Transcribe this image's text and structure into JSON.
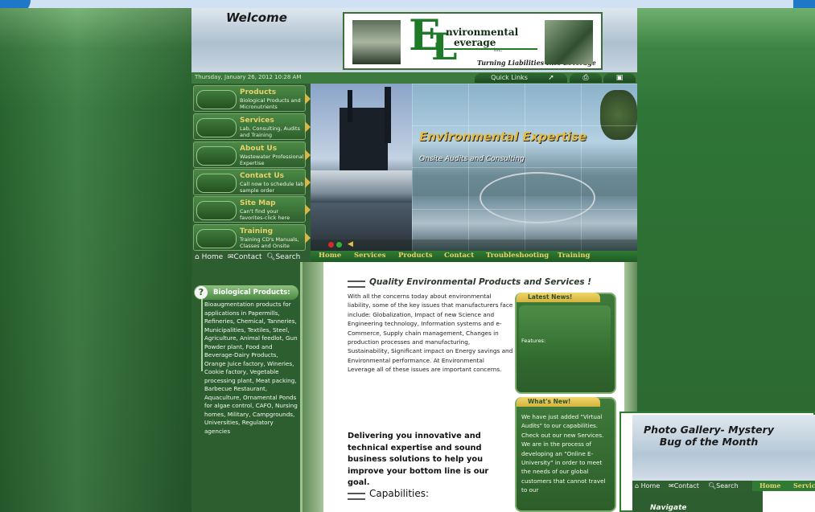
{
  "header": {
    "welcome": "Welcome",
    "logo": {
      "big_e": "E",
      "big_l": "L",
      "word1": "nvironmental",
      "word2": "everage",
      "inc": "inc.",
      "tagline": "Turning Liabilities Into Leverage"
    },
    "date": "Thursday, January 26, 2012        10:28 AM",
    "quick_links": "Quick Links"
  },
  "nav": [
    {
      "title": "Products",
      "desc": "Biological Products and Micronutrients"
    },
    {
      "title": "Services",
      "desc": "Lab, Consulting, Audits and Training"
    },
    {
      "title": "About Us",
      "desc": "Wastewater Professional Expertise"
    },
    {
      "title": "Contact Us",
      "desc": "Call now to schedule lab sample order"
    },
    {
      "title": "Site Map",
      "desc": "Can't find your favorites-click here"
    },
    {
      "title": "Training",
      "desc": "Training CD's Manuals, Classes and Onsite"
    }
  ],
  "utility": {
    "home": "Home",
    "contact": "Contact",
    "search": "Search"
  },
  "hero": {
    "title": "Environmental Expertise",
    "subtitle": "Onsite Audits and Consulting"
  },
  "topnav": [
    "Home",
    "Services",
    "Products",
    "Contact",
    "Troubleshooting",
    "Training"
  ],
  "bio": {
    "title": "Biological Products:",
    "text": "Bioaugmentation products for applications in Papermills, Refineries, Chemical, Tanneries, Municipalities, Textiles, Steel, Agriculture, Animal feedlot, Gun Powder plant, Food and Beverage-Dairy Products, Orange Juice factory, Wineries, Cookie factory, Vegetable processing plant, Meat packing, Barbecue Restaurant, Aquaculture, Ornamental Ponds for algae control, CAFO, Nursing homes, Military, Campgrounds, Universities, Regulatory agencies"
  },
  "main": {
    "heading": "Quality Environmental Products and Services !",
    "intro": "With all the concerns today about environmental liability, some of the key issues that manufacturers face include: Globalization, Impact of new Science and Engineering technology, Information systems and e-Commerce, Supply chain management, Changes in production processes and manufacturing, Sustainability, Significant impact on Energy savings and Environmental performance. At Environmental Leverage all of these issues are important concerns.",
    "deliver": "Delivering you innovative and technical expertise and sound business solutions to help you improve your bottom line is our goal.",
    "capabilities": "Capabilities:"
  },
  "latest_news": {
    "label": "Latest News!",
    "features": "Features:"
  },
  "whats_new": {
    "label": "What's New!",
    "text": "We have just added \"Virtual Audits\" to our capabilities. Check out our new Services. We are in the process of developing an \"Online E-University\" in order to meet the needs of our global customers that cannot travel to our"
  },
  "popup": {
    "title": "Photo Gallery- Mystery Bug of the Month",
    "home": "Home",
    "contact": "Contact",
    "search": "Search",
    "nav_home": "Home",
    "nav_services": "Servic",
    "navigate": "Navigate"
  },
  "colors": {
    "brand_green": "#1e7a27",
    "accent_gold": "#e3bb45",
    "nav_text": "#e7d26d"
  },
  "icons": [
    "home-icon",
    "envelope-icon",
    "search-icon",
    "back-arrow-icon",
    "print-icon",
    "gift-icon",
    "question-icon",
    "speaker-icon"
  ]
}
